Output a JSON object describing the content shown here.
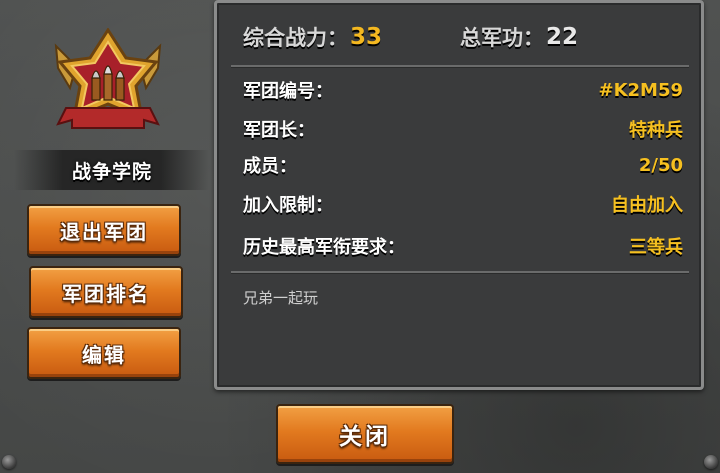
{
  "legion": {
    "name": "战争学院",
    "emblem": "bullets-badge-icon"
  },
  "buttons": {
    "quit": "退出军团",
    "rank": "军团排名",
    "edit": "编辑",
    "close": "关闭"
  },
  "stats": {
    "power_label": "综合战力：",
    "power_value": "33",
    "merit_label": "总军功：",
    "merit_value": "22"
  },
  "info": [
    {
      "label": "军团编号：",
      "value": "#K2M59"
    },
    {
      "label": "军团长：",
      "value": "特种兵"
    },
    {
      "label": "成员：",
      "value": "2/50"
    },
    {
      "label": "加入限制：",
      "value": "自由加入"
    },
    {
      "label": "历史最高军衔要求：",
      "value": "三等兵"
    }
  ],
  "motto": "兄弟一起玩",
  "colors": {
    "accent_gold": "#f6c020",
    "button_orange": "#e27a1f",
    "panel_bg": "#3a3b3c"
  }
}
